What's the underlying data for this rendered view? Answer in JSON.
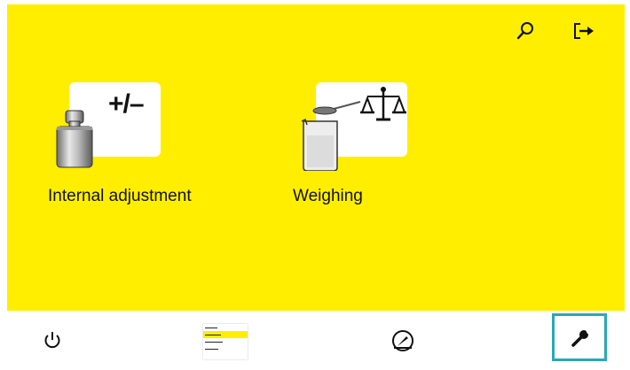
{
  "header": {
    "icons": {
      "search": "search-icon",
      "exit": "logout-icon"
    }
  },
  "tiles": [
    {
      "label": "Internal adjustment",
      "icon": "weight-adjust-icon",
      "symbol": "+/–"
    },
    {
      "label": "Weighing",
      "icon": "beaker-scale-icon"
    }
  ],
  "bottom_bar": {
    "items": [
      {
        "icon": "power-icon"
      },
      {
        "icon": "task-list-icon"
      },
      {
        "icon": "gauge-icon"
      },
      {
        "icon": "wrench-icon",
        "selected": true
      }
    ]
  },
  "colors": {
    "accent": "#ffee00",
    "selection": "#2aa7b8",
    "text": "#111111"
  }
}
